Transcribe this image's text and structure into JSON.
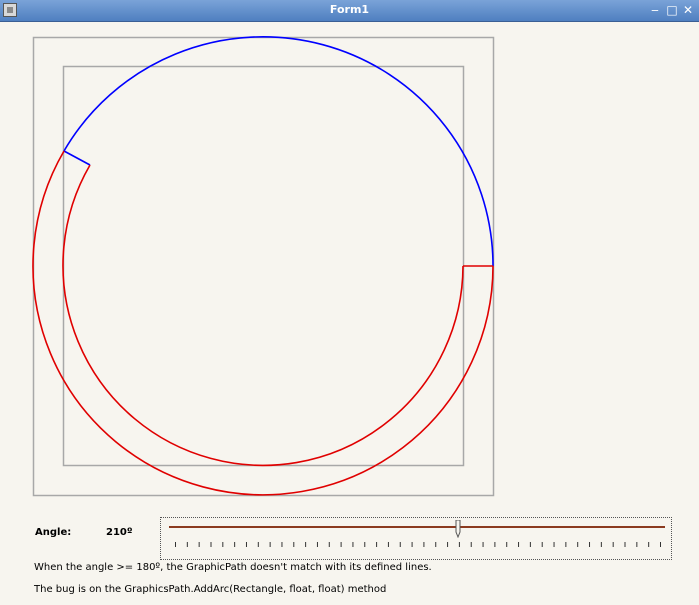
{
  "window": {
    "title": "Form1"
  },
  "controls": {
    "angle_label": "Angle:",
    "angle_value": "210º"
  },
  "slider": {
    "value": 210,
    "min": 0,
    "max": 360,
    "tick_count": 42
  },
  "messages": {
    "line1": "When the angle >= 180º, the GraphicPath doesn't match with its defined lines.",
    "line2": "The bug is on the GraphicsPath.AddArc(Rectangle, float, float) method"
  },
  "colors": {
    "arc_blue": "#0000ff",
    "arc_red": "#e00000",
    "rect_gray": "#a8a8a8"
  }
}
